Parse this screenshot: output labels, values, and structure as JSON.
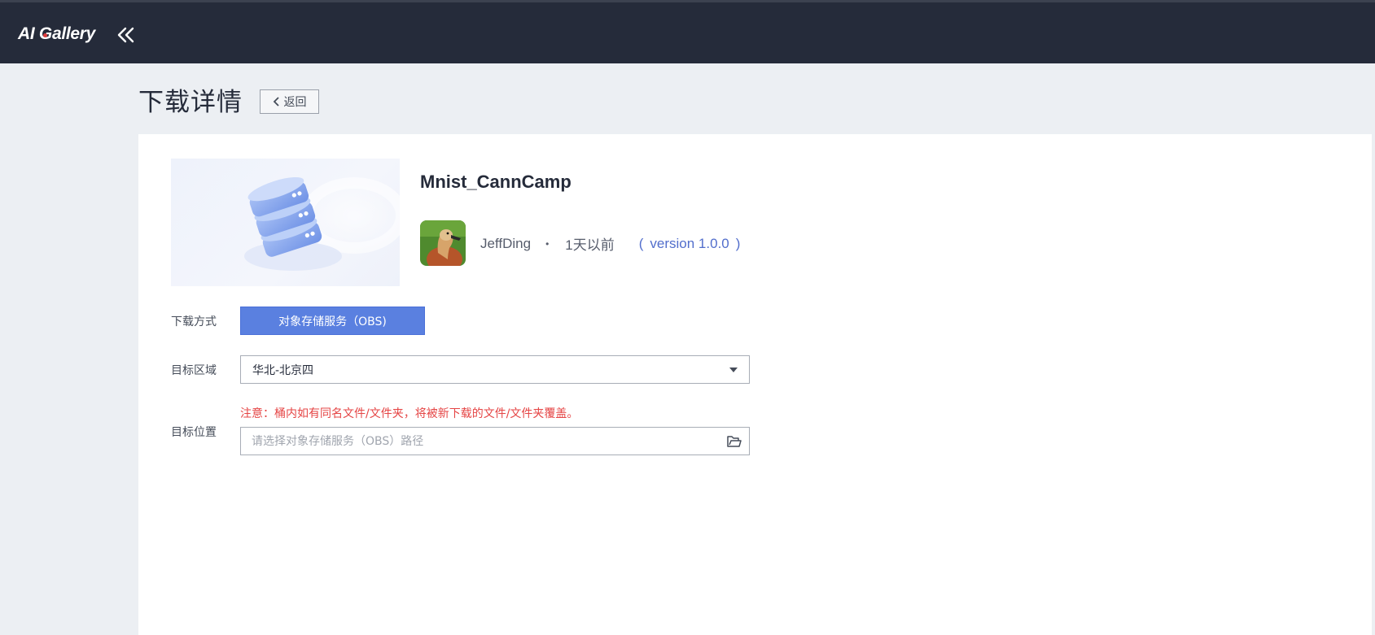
{
  "topbar": {
    "logo_text_left": "AI G",
    "logo_text_right": "allery",
    "collapse_icon": "double-chevron-left-icon",
    "background": "#252b3a"
  },
  "page": {
    "title": "下载详情",
    "back_label": "返回"
  },
  "dataset": {
    "name": "Mnist_CannCamp",
    "author": "JeffDing",
    "dot": "•",
    "time": "1天以前",
    "paren_open": "(",
    "version": "version 1.0.0",
    "paren_close": ")",
    "cover_icon": "database-icon",
    "avatar_icon": "duck-avatar"
  },
  "form": {
    "method_label": "下载方式",
    "method_value": "对象存储服务（OBS)",
    "region_label": "目标区域",
    "region_value": "华北-北京四",
    "location_label": "目标位置",
    "warning": "注意：桶内如有同名文件/文件夹，将被新下载的文件/文件夹覆盖。",
    "location_placeholder": "请选择对象存储服务（OBS）路径",
    "location_value": ""
  },
  "colors": {
    "accent": "#5a80e0",
    "link": "#526ecc",
    "warning": "#e54545"
  }
}
